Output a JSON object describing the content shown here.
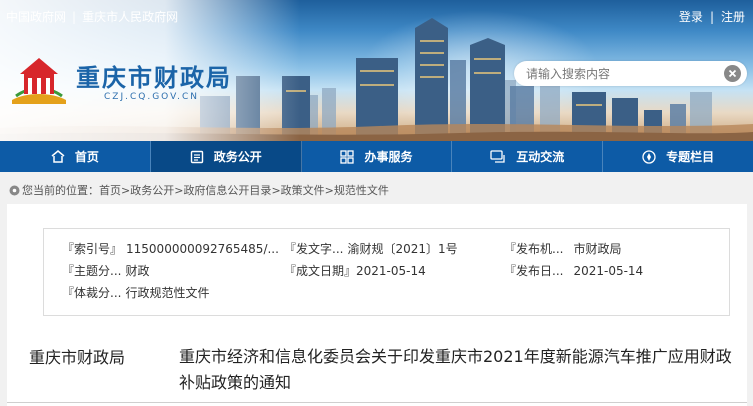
{
  "header": {
    "top_links": [
      "中国政府网",
      "重庆市人民政府网"
    ],
    "user_links": [
      "登录",
      "注册"
    ],
    "site_name": "重庆市财政局",
    "site_domain": "CZJ.CQ.GOV.CN",
    "search_placeholder": "请输入搜索内容"
  },
  "nav": {
    "items": [
      {
        "label": "首页",
        "icon": "home-icon",
        "active": false
      },
      {
        "label": "政务公开",
        "icon": "document-icon",
        "active": true
      },
      {
        "label": "办事服务",
        "icon": "grid-icon",
        "active": false
      },
      {
        "label": "互动交流",
        "icon": "chat-icon",
        "active": false
      },
      {
        "label": "专题栏目",
        "icon": "compass-icon",
        "active": false
      }
    ]
  },
  "breadcrumb": {
    "prefix": "您当前的位置：",
    "items": [
      "首页",
      "政务公开",
      "政府信息公开目录",
      "政策文件",
      "规范性文件"
    ],
    "separator": ">"
  },
  "meta": {
    "rows": [
      [
        {
          "label": "『索引号』",
          "value": "115000000092765485/..."
        },
        {
          "label": "『发文字...",
          "value": "渝财规〔2021〕1号"
        },
        {
          "label": "『发布机...",
          "value": "市财政局"
        }
      ],
      [
        {
          "label": "『主题分...",
          "value": "财政"
        },
        {
          "label": "『成文日期』",
          "value": "2021-05-14"
        },
        {
          "label": "『发布日...",
          "value": "2021-05-14"
        }
      ],
      [
        {
          "label": "『体裁分...",
          "value": "行政规范性文件"
        }
      ]
    ]
  },
  "article": {
    "department": "重庆市财政局",
    "title": "重庆市经济和信息化委员会关于印发重庆市2021年度新能源汽车推广应用财政补贴政策的通知"
  },
  "colors": {
    "nav_bg": "#0d5ba6",
    "nav_active": "#084987",
    "brand": "#1b64a8"
  }
}
